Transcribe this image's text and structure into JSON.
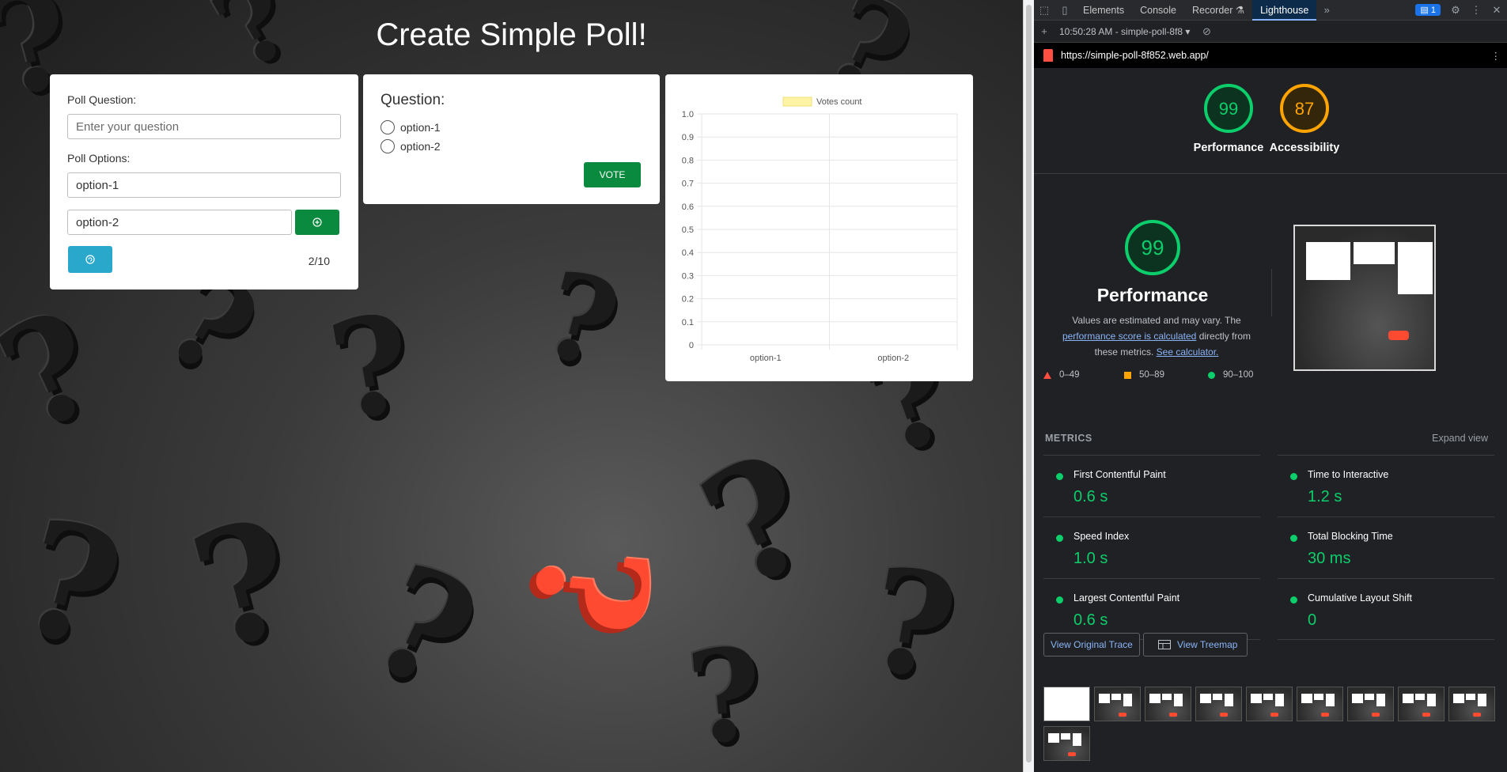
{
  "app": {
    "title": "Create Simple Poll!",
    "form": {
      "question_label": "Poll Question:",
      "question_placeholder": "Enter your question",
      "question_value": "",
      "options_label": "Poll Options:",
      "option_values": [
        "option-1",
        "option-2"
      ],
      "add_option_icon": "plus-circle-icon",
      "reset_icon": "refresh-icon",
      "option_count": "2/10"
    },
    "vote": {
      "title": "Question:",
      "options": [
        "option-1",
        "option-2"
      ],
      "vote_label": "VOTE"
    }
  },
  "chart_data": {
    "type": "bar",
    "title": "",
    "categories": [
      "option-1",
      "option-2"
    ],
    "series": [
      {
        "name": "Votes count",
        "values": [
          0,
          0
        ],
        "color": "#fff3a6"
      }
    ],
    "ylim": [
      0,
      1.0
    ],
    "yticks": [
      "0",
      "0.1",
      "0.2",
      "0.3",
      "0.4",
      "0.5",
      "0.6",
      "0.7",
      "0.8",
      "0.9",
      "1.0"
    ],
    "grid": true,
    "legend": "top-center"
  },
  "devtools": {
    "tabs": [
      "Elements",
      "Console",
      "Recorder",
      "Lighthouse"
    ],
    "active_tab": "Lighthouse",
    "issues_badge": "1",
    "report_label": "10:50:28 AM - simple-poll-8f8",
    "url": "https://simple-poll-8f852.web.app/",
    "gauges": [
      {
        "label": "Performance",
        "score": "99",
        "color": "#0cce6b",
        "fraction": 0.99
      },
      {
        "label": "Accessibility",
        "score": "87",
        "color": "#ffa400",
        "fraction": 0.87
      }
    ],
    "performance": {
      "score": "99",
      "title": "Performance",
      "desc_1": "Values are estimated and may vary. The",
      "link_1": "performance score is calculated",
      "desc_2": "directly from these metrics.",
      "link_2": "See calculator."
    },
    "legend": [
      {
        "range": "0–49",
        "color": "#ff4e42"
      },
      {
        "range": "50–89",
        "color": "#ffa400"
      },
      {
        "range": "90–100",
        "color": "#0cce6b"
      }
    ],
    "metrics_heading": "METRICS",
    "expand_label": "Expand view",
    "metrics": [
      {
        "name": "First Contentful Paint",
        "value": "0.6 s"
      },
      {
        "name": "Time to Interactive",
        "value": "1.2 s"
      },
      {
        "name": "Speed Index",
        "value": "1.0 s"
      },
      {
        "name": "Total Blocking Time",
        "value": "30 ms"
      },
      {
        "name": "Largest Contentful Paint",
        "value": "0.6 s"
      },
      {
        "name": "Cumulative Layout Shift",
        "value": "0"
      }
    ],
    "view_trace_label": "View Original Trace",
    "view_treemap_label": "View Treemap"
  }
}
